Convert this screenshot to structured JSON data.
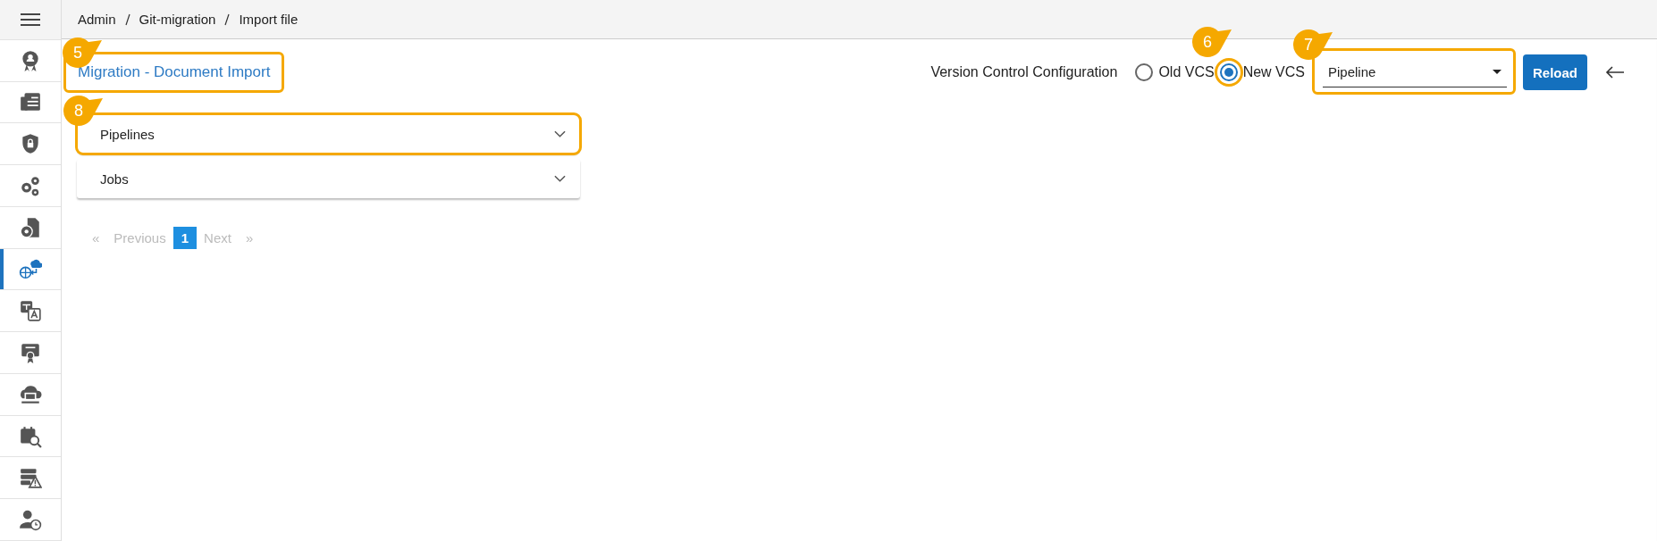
{
  "breadcrumb": [
    "Admin",
    "Git-migration",
    "Import file"
  ],
  "sidebar": {
    "items": [
      {
        "selected": false
      },
      {
        "selected": false
      },
      {
        "selected": false
      },
      {
        "selected": false
      },
      {
        "selected": false
      },
      {
        "selected": true
      },
      {
        "selected": false
      },
      {
        "selected": false
      },
      {
        "selected": false
      },
      {
        "selected": false
      },
      {
        "selected": false
      },
      {
        "selected": false
      }
    ]
  },
  "title": {
    "text": "Migration - Document Import",
    "callout": "5"
  },
  "vcs": {
    "label": "Version Control Configuration",
    "options": [
      {
        "label": "Old VCS",
        "selected": false
      },
      {
        "label": "New VCS",
        "selected": true,
        "callout": "6"
      }
    ]
  },
  "dropdown": {
    "value": "Pipeline",
    "callout": "7"
  },
  "reload_button": "Reload",
  "accordion": [
    {
      "label": "Pipelines",
      "expanded": false,
      "callout": "8"
    },
    {
      "label": "Jobs",
      "expanded": false
    }
  ],
  "pagination": {
    "first": "«",
    "previous": "Previous",
    "pages": [
      {
        "label": "1",
        "selected": true
      }
    ],
    "next": "Next",
    "last": "»"
  }
}
